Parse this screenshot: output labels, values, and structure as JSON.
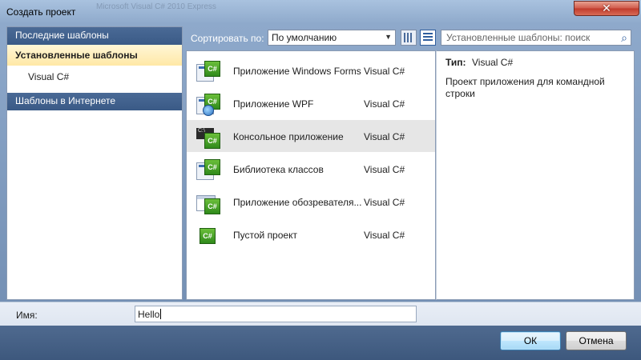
{
  "window": {
    "title": "Создать проект",
    "ghost_title": "Microsoft Visual C# 2010 Express"
  },
  "left_panel": {
    "recent": "Последние шаблоны",
    "installed": "Установленные шаблоны",
    "installed_child": "Visual C#",
    "online": "Шаблоны в Интернете"
  },
  "toolbar": {
    "sort_label": "Сортировать по:",
    "sort_value": "По умолчанию",
    "search_placeholder": "Установленные шаблоны: поиск"
  },
  "templates": [
    {
      "name": "Приложение Windows Forms",
      "lang": "Visual C#",
      "icon": "windows-forms-icon",
      "selected": false
    },
    {
      "name": "Приложение WPF",
      "lang": "Visual C#",
      "icon": "wpf-icon",
      "selected": false
    },
    {
      "name": "Консольное приложение",
      "lang": "Visual C#",
      "icon": "console-app-icon",
      "selected": true
    },
    {
      "name": "Библиотека классов",
      "lang": "Visual C#",
      "icon": "class-library-icon",
      "selected": false
    },
    {
      "name": "Приложение обозревателя...",
      "lang": "Visual C#",
      "icon": "browser-app-icon",
      "selected": false
    },
    {
      "name": "Пустой проект",
      "lang": "Visual C#",
      "icon": "empty-project-icon",
      "selected": false
    }
  ],
  "info": {
    "type_label": "Тип:",
    "type_value": "Visual C#",
    "description": "Проект приложения для командной строки"
  },
  "name_field": {
    "label": "Имя:",
    "value": "Hello"
  },
  "buttons": {
    "ok": "ОК",
    "cancel": "Отмена"
  },
  "icons": {
    "cs_glyph": "C#",
    "cmd_glyph": "C:\\",
    "close_glyph": "✕",
    "search_glyph": "⌕",
    "dropdown_glyph": "▼"
  }
}
